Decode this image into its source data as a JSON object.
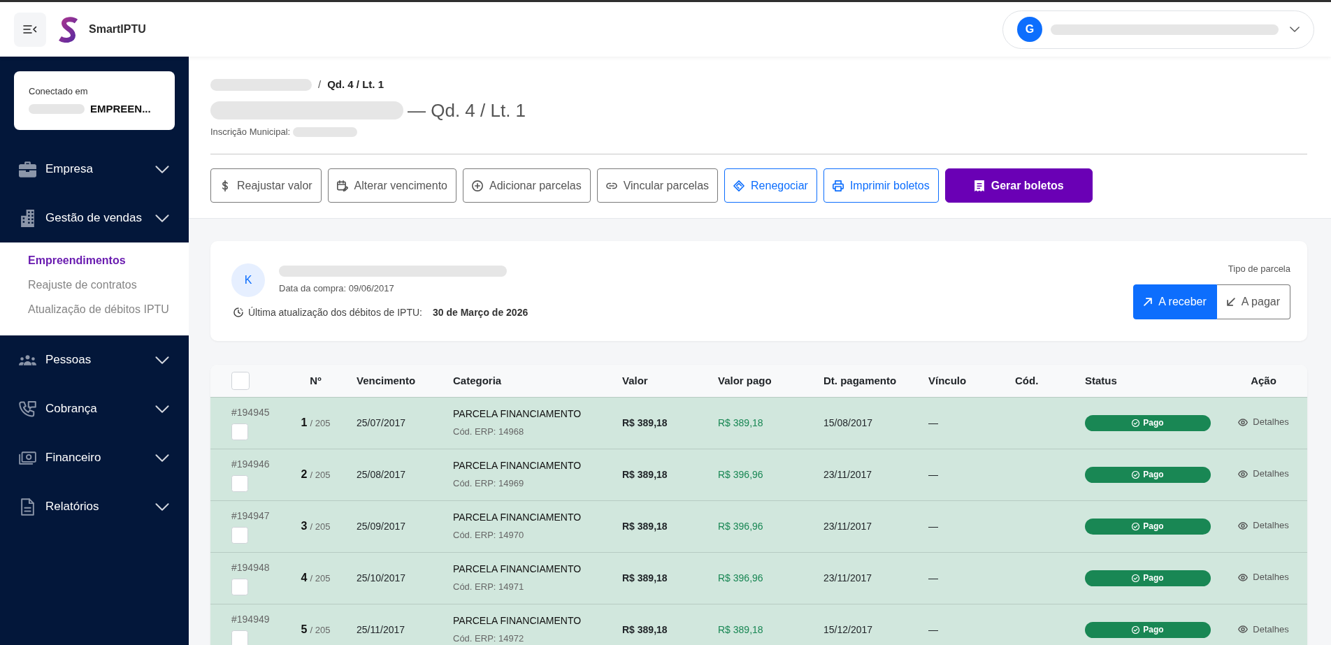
{
  "topbar": {
    "brand": "SmartIPTU",
    "user": {
      "initial": "G",
      "name_redacted": true
    }
  },
  "sidebar": {
    "connection": {
      "label": "Conectado em",
      "value": "EMPREEN...",
      "value_redacted": true
    },
    "items": [
      {
        "label": "Empresa",
        "expanded": false
      },
      {
        "label": "Gestão de vendas",
        "expanded": true,
        "children": [
          {
            "label": "Empreendimentos",
            "selected": true
          },
          {
            "label": "Reajuste de contratos",
            "selected": false
          },
          {
            "label": "Atualização de débitos IPTU",
            "selected": false
          }
        ]
      },
      {
        "label": "Pessoas",
        "expanded": false
      },
      {
        "label": "Cobrança",
        "expanded": false
      },
      {
        "label": "Financeiro",
        "expanded": false
      },
      {
        "label": "Relatórios",
        "expanded": false
      }
    ]
  },
  "page_header": {
    "breadcrumb": {
      "parent_redacted": true,
      "separator": "/",
      "current": "Qd. 4 / Lt. 1"
    },
    "title": {
      "name_redacted": true,
      "suffix": "— Qd. 4 / Lt. 1"
    },
    "registration": {
      "label": "Inscrição Municipal:",
      "value_redacted": true
    }
  },
  "actions": [
    {
      "label": "Reajustar valor",
      "kind": "outline"
    },
    {
      "label": "Alterar vencimento",
      "kind": "outline"
    },
    {
      "label": "Adicionar parcelas",
      "kind": "outline"
    },
    {
      "label": "Vincular parcelas",
      "kind": "outline"
    },
    {
      "label": "Renegociar",
      "kind": "outline-primary"
    },
    {
      "label": "Imprimir boletos",
      "kind": "outline-primary"
    },
    {
      "label": "Gerar boletos",
      "kind": "solid"
    }
  ],
  "customer": {
    "initial": "K",
    "name_redacted": true,
    "purchase_date": "Data da compra: 09/06/2017",
    "update_label": "Última atualização dos débitos de IPTU:",
    "update_date": "30 de Março de 2026",
    "type_label": "Tipo de parcela",
    "type_options": [
      {
        "label": "A receber",
        "selected": true
      },
      {
        "label": "A pagar",
        "selected": false
      }
    ]
  },
  "table": {
    "select_all": {
      "checked": false
    },
    "columns": [
      "Nº",
      "Vencimento",
      "Categoria",
      "Valor",
      "Valor pago",
      "Dt. pagamento",
      "Vínculo",
      "Cód.",
      "Status",
      "Ação"
    ],
    "rows": [
      {
        "id": "#194945",
        "checked": false,
        "number": "1",
        "total": "/ 205",
        "due": "25/07/2017",
        "category": "PARCELA FINANCIAMENTO",
        "erp": "Cód. ERP: 14968",
        "value": "R$ 389,18",
        "paid": "R$ 389,18",
        "paid_date": "15/08/2017",
        "link": "—",
        "status": {
          "label": "Pago",
          "kind": "paid"
        },
        "action": "Detalhes"
      },
      {
        "id": "#194946",
        "checked": false,
        "number": "2",
        "total": "/ 205",
        "due": "25/08/2017",
        "category": "PARCELA FINANCIAMENTO",
        "erp": "Cód. ERP: 14969",
        "value": "R$ 389,18",
        "paid": "R$ 396,96",
        "paid_date": "23/11/2017",
        "link": "—",
        "status": {
          "label": "Pago",
          "kind": "paid"
        },
        "action": "Detalhes"
      },
      {
        "id": "#194947",
        "checked": false,
        "number": "3",
        "total": "/ 205",
        "due": "25/09/2017",
        "category": "PARCELA FINANCIAMENTO",
        "erp": "Cód. ERP: 14970",
        "value": "R$ 389,18",
        "paid": "R$ 396,96",
        "paid_date": "23/11/2017",
        "link": "—",
        "status": {
          "label": "Pago",
          "kind": "paid"
        },
        "action": "Detalhes"
      },
      {
        "id": "#194948",
        "checked": false,
        "number": "4",
        "total": "/ 205",
        "due": "25/10/2017",
        "category": "PARCELA FINANCIAMENTO",
        "erp": "Cód. ERP: 14971",
        "value": "R$ 389,18",
        "paid": "R$ 396,96",
        "paid_date": "23/11/2017",
        "link": "—",
        "status": {
          "label": "Pago",
          "kind": "paid"
        },
        "action": "Detalhes"
      },
      {
        "id": "#194949",
        "checked": false,
        "number": "5",
        "total": "/ 205",
        "due": "25/11/2017",
        "category": "PARCELA FINANCIAMENTO",
        "erp": "Cód. ERP: 14972",
        "value": "R$ 389,18",
        "paid": "R$ 389,18",
        "paid_date": "15/12/2017",
        "link": "—",
        "status": {
          "label": "Pago",
          "kind": "paid"
        },
        "action": "Detalhes"
      }
    ]
  }
}
